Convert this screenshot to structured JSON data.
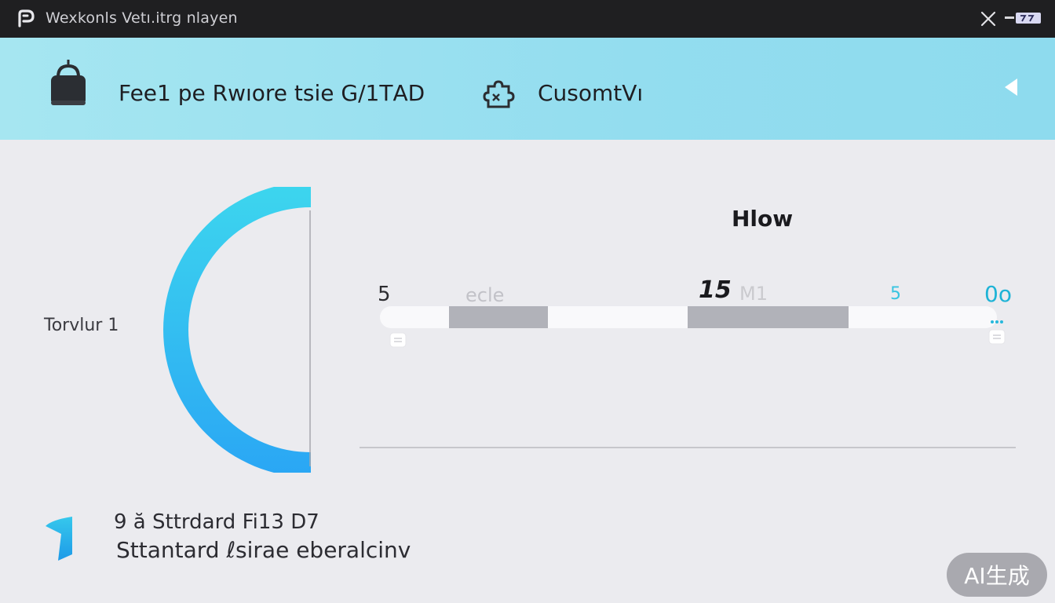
{
  "window": {
    "title": "Wexkonls  Vetı.itrg nlayen",
    "logo_icon": "app-logo-icon",
    "close_icon": "close-icon"
  },
  "header": {
    "title": "Fee1 pe Rwıore tsie G/1ТAD",
    "lock_icon": "lock-icon",
    "puzzle_icon": "puzzle-icon",
    "custom_label": "CusomtVı",
    "collapse_icon": "chevron-left-icon"
  },
  "gauge": {
    "label": "Torvlur 1",
    "fraction": 0.5
  },
  "flow": {
    "title": "Hlow",
    "start_label": "5",
    "scale_label": "ecle",
    "mid_label": "15",
    "mid_sublabel": "M1",
    "small_label": "5",
    "end_label": "0o"
  },
  "footer": {
    "line1": "9 ӑ Sttrdard Fi13 D7",
    "line2": "Sttantard ℓsirae eberalcinv",
    "icon": "bookmark-icon"
  },
  "watermark": "AI生成",
  "colors": {
    "accent": "#36c8ec",
    "banner": "#93ddef",
    "titlebar": "#1f1f21",
    "segment": "#b1b2b9"
  }
}
